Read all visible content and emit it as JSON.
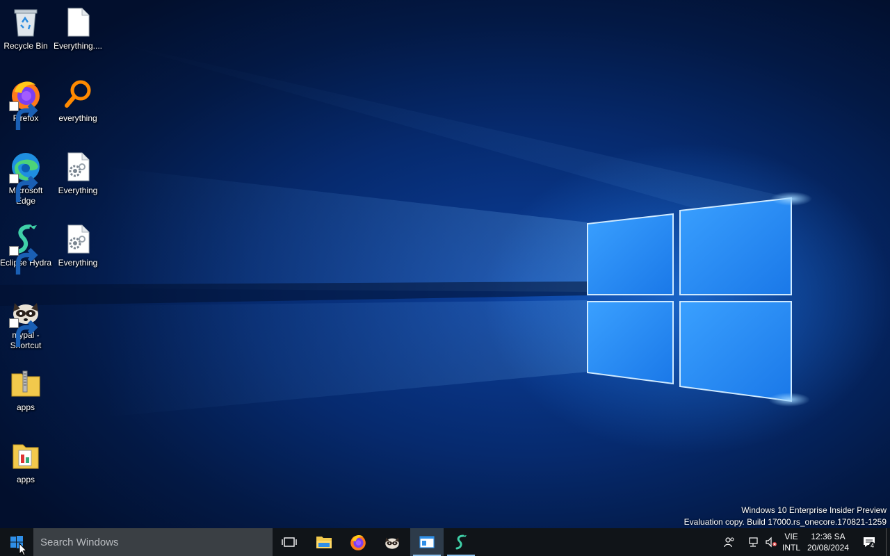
{
  "desktop": {
    "icons": [
      {
        "label": "Recycle Bin",
        "icon": "recycle-bin-icon"
      },
      {
        "label": "Everything....",
        "icon": "blank-document-icon"
      },
      {
        "label": "Firefox",
        "icon": "firefox-icon"
      },
      {
        "label": "everything",
        "icon": "everything-search-icon"
      },
      {
        "label": "Microsoft Edge",
        "icon": "edge-icon"
      },
      {
        "label": "Everything",
        "icon": "settings-document-icon"
      },
      {
        "label": "Eclipse Hydra",
        "icon": "eclipse-hydra-icon"
      },
      {
        "label": "Everything",
        "icon": "settings-document-icon"
      },
      {
        "label": "mypal - Shortcut",
        "icon": "mypal-raccoon-icon"
      },
      {
        "label": "apps",
        "icon": "zip-folder-icon"
      },
      {
        "label": "apps",
        "icon": "archive-folder-icon"
      }
    ],
    "watermark": {
      "line1": "Windows 10 Enterprise Insider Preview",
      "line2": "Evaluation copy. Build 17000.rs_onecore.170821-1259"
    }
  },
  "taskbar": {
    "search_placeholder": "Search Windows",
    "pinned": [
      {
        "name": "task-view",
        "icon": "task-view-icon"
      },
      {
        "name": "file-explorer",
        "icon": "folder-icon"
      },
      {
        "name": "firefox",
        "icon": "firefox-icon"
      },
      {
        "name": "mypal",
        "icon": "mypal-raccoon-icon"
      },
      {
        "name": "active-window",
        "icon": "window-app-icon"
      },
      {
        "name": "eclipse-hydra",
        "icon": "eclipse-hydra-icon"
      }
    ],
    "tray": {
      "language_line1": "VIE",
      "language_line2": "INTL",
      "time": "12:36 SA",
      "date": "20/08/2024",
      "notification_count": "4"
    }
  },
  "colors": {
    "taskbar": "#101418",
    "search_box": "#3a3f44",
    "accent": "#1e90ff"
  }
}
